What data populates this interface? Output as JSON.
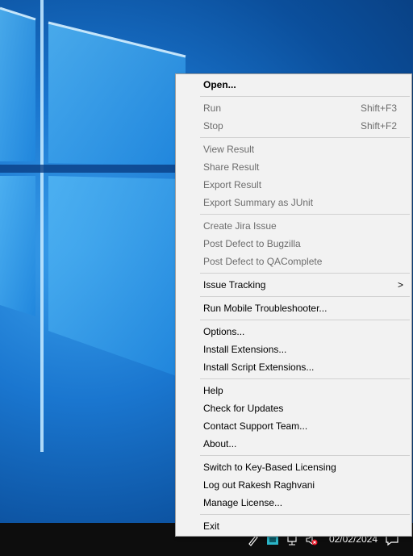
{
  "menu": {
    "open": "Open...",
    "run": "Run",
    "run_shortcut": "Shift+F3",
    "stop": "Stop",
    "stop_shortcut": "Shift+F2",
    "view_result": "View Result",
    "share_result": "Share Result",
    "export_result": "Export Result",
    "export_junit": "Export Summary as JUnit",
    "create_jira": "Create Jira Issue",
    "post_bugzilla": "Post Defect to Bugzilla",
    "post_qacomplete": "Post Defect to QAComplete",
    "issue_tracking": "Issue Tracking",
    "issue_tracking_arrow": ">",
    "run_mobile": "Run Mobile Troubleshooter...",
    "options": "Options...",
    "install_extensions": "Install Extensions...",
    "install_script_extensions": "Install Script Extensions...",
    "help": "Help",
    "check_updates": "Check for Updates",
    "contact_support": "Contact Support Team...",
    "about": "About...",
    "switch_licensing": "Switch to Key-Based Licensing",
    "log_out": "Log out Rakesh Raghvani",
    "manage_license": "Manage License...",
    "exit": "Exit"
  },
  "taskbar": {
    "clock_date": "02/02/2024"
  }
}
